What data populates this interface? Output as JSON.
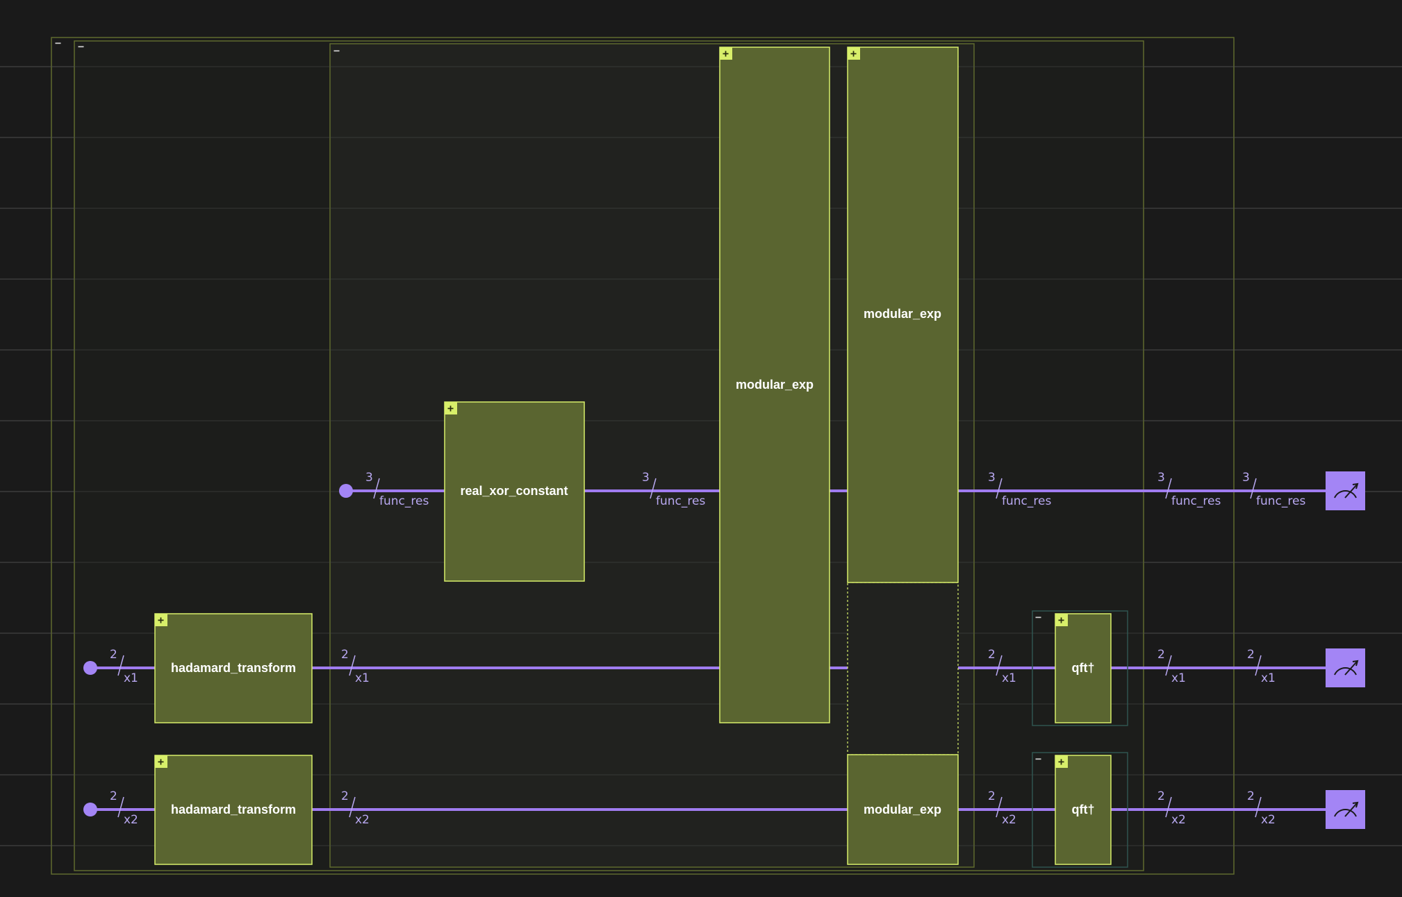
{
  "circuit": {
    "registers": [
      {
        "id": "func_res",
        "size": "3",
        "label": "func_res"
      },
      {
        "id": "x1",
        "size": "2",
        "label": "x1"
      },
      {
        "id": "x2",
        "size": "2",
        "label": "x2"
      }
    ],
    "gates": [
      {
        "id": "hadamard-x1",
        "label": "hadamard_transform"
      },
      {
        "id": "hadamard-x2",
        "label": "hadamard_transform"
      },
      {
        "id": "real-xor",
        "label": "real_xor_constant"
      },
      {
        "id": "modexp-1",
        "label": "modular_exp"
      },
      {
        "id": "modexp-2-top",
        "label": "modular_exp"
      },
      {
        "id": "modexp-2-bottom",
        "label": "modular_exp"
      },
      {
        "id": "qft-x1",
        "label": "qft†"
      },
      {
        "id": "qft-x2",
        "label": "qft†"
      }
    ],
    "expand_symbol": "+",
    "collapse_symbol": "−",
    "icons": {
      "measure": "measurement-meter-icon",
      "init": "qubit-init-dot-icon"
    },
    "colors": {
      "background": "#1a1a1a",
      "gate_fill": "#5a6530",
      "gate_border": "#d8ef6a",
      "wire": "#a07cf0",
      "measure_fill": "#a385f5",
      "frame_border": "#5f6a2e",
      "qft_frame_border": "#2f5550",
      "grid": "#4a4a4a"
    }
  }
}
